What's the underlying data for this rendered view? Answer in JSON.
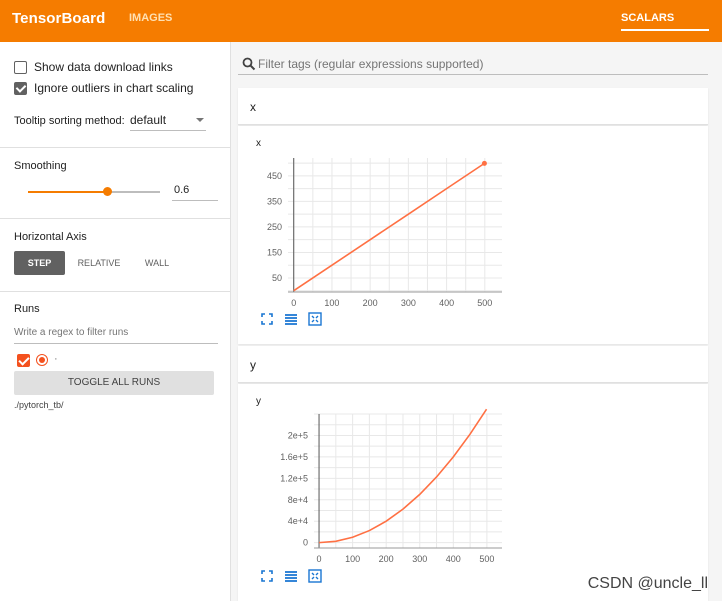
{
  "topbar": {
    "brand": "TensorBoard",
    "nav_images": "IMAGES",
    "nav_scalars": "SCALARS",
    "bg_color": "#f57c00"
  },
  "sidebar": {
    "show_download_links": {
      "label": "Show data download links",
      "checked": false
    },
    "ignore_outliers": {
      "label": "Ignore outliers in chart scaling",
      "checked": true
    },
    "tooltip_sorting": {
      "label": "Tooltip sorting method:",
      "value": "default"
    },
    "smoothing": {
      "label": "Smoothing",
      "value": "0.6",
      "level": 0.6
    },
    "horizontal_axis": {
      "label": "Horizontal Axis",
      "options": [
        "STEP",
        "RELATIVE",
        "WALL"
      ],
      "selected": "STEP"
    },
    "runs": {
      "label": "Runs",
      "filter_placeholder": "Write a regex to filter runs",
      "run_item_label": "·",
      "toggle_all": "TOGGLE ALL RUNS",
      "logdir": "./pytorch_tb/"
    }
  },
  "main": {
    "search_placeholder": "Filter tags (regular expressions supported)"
  },
  "cards": [
    {
      "header": "x",
      "chart_title": "x"
    },
    {
      "header": "y",
      "chart_title": "y"
    }
  ],
  "chart_data": [
    {
      "type": "line",
      "title": "x",
      "xlabel": "",
      "ylabel": "",
      "x_ticks": [
        "0",
        "100",
        "200",
        "300",
        "400",
        "500"
      ],
      "y_ticks": [
        "50",
        "150",
        "250",
        "350",
        "450"
      ],
      "xlim": [
        -15,
        545
      ],
      "ylim": [
        -5,
        520
      ],
      "grid": true,
      "series": [
        {
          "color": "#ff7043",
          "x": [
            0,
            100,
            200,
            300,
            400,
            499
          ],
          "y": [
            0,
            100,
            200,
            300,
            400,
            499
          ]
        }
      ]
    },
    {
      "type": "line",
      "title": "y",
      "xlabel": "",
      "ylabel": "",
      "x_ticks": [
        "0",
        "100",
        "200",
        "300",
        "400",
        "500"
      ],
      "y_ticks": [
        "0",
        "4e+4",
        "8e+4",
        "1.2e+5",
        "1.6e+5",
        "2e+5"
      ],
      "xlim": [
        -15,
        545
      ],
      "ylim": [
        -10000,
        240000
      ],
      "grid": true,
      "series": [
        {
          "color": "#ff7043",
          "x": [
            0,
            50,
            100,
            150,
            200,
            250,
            300,
            350,
            400,
            450,
            499
          ],
          "y": [
            0,
            2500,
            10000,
            22500,
            40000,
            62500,
            90000,
            122500,
            160000,
            202500,
            249001
          ]
        }
      ]
    }
  ],
  "watermark": "CSDN @uncle_ll"
}
